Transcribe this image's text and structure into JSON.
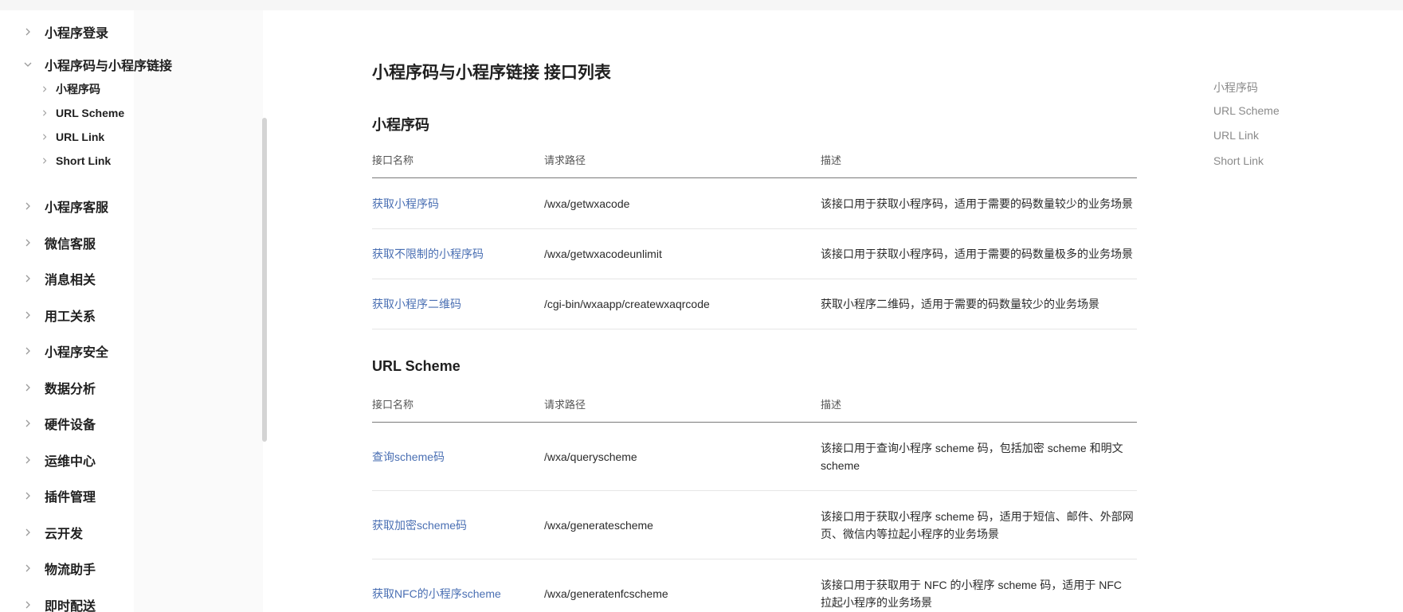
{
  "sidebar": {
    "items": [
      {
        "label": "小程序登录",
        "expanded": false
      },
      {
        "label": "小程序码与小程序链接",
        "expanded": true
      },
      {
        "label": "小程序客服",
        "expanded": false
      },
      {
        "label": "微信客服",
        "expanded": false
      },
      {
        "label": "消息相关",
        "expanded": false
      },
      {
        "label": "用工关系",
        "expanded": false
      },
      {
        "label": "小程序安全",
        "expanded": false
      },
      {
        "label": "数据分析",
        "expanded": false
      },
      {
        "label": "硬件设备",
        "expanded": false
      },
      {
        "label": "运维中心",
        "expanded": false
      },
      {
        "label": "插件管理",
        "expanded": false
      },
      {
        "label": "云开发",
        "expanded": false
      },
      {
        "label": "物流助手",
        "expanded": false
      },
      {
        "label": "即时配送",
        "expanded": false
      }
    ],
    "subitems": [
      {
        "label": "小程序码"
      },
      {
        "label": "URL Scheme"
      },
      {
        "label": "URL Link"
      },
      {
        "label": "Short Link"
      }
    ]
  },
  "main": {
    "title": "小程序码与小程序链接 接口列表",
    "columns": [
      "接口名称",
      "请求路径",
      "描述"
    ],
    "sections": [
      {
        "title": "小程序码",
        "rows": [
          {
            "name": "获取小程序码",
            "path": "/wxa/getwxacode",
            "desc": "该接口用于获取小程序码，适用于需要的码数量较少的业务场景"
          },
          {
            "name": "获取不限制的小程序码",
            "path": "/wxa/getwxacodeunlimit",
            "desc": "该接口用于获取小程序码，适用于需要的码数量极多的业务场景"
          },
          {
            "name": "获取小程序二维码",
            "path": "/cgi-bin/wxaapp/createwxaqrcode",
            "desc": "获取小程序二维码，适用于需要的码数量较少的业务场景"
          }
        ]
      },
      {
        "title": "URL Scheme",
        "rows": [
          {
            "name": "查询scheme码",
            "path": "/wxa/queryscheme",
            "desc": "该接口用于查询小程序 scheme 码，包括加密 scheme 和明文 scheme"
          },
          {
            "name": "获取加密scheme码",
            "path": "/wxa/generatescheme",
            "desc": "该接口用于获取小程序 scheme 码，适用于短信、邮件、外部网页、微信内等拉起小程序的业务场景"
          },
          {
            "name": "获取NFC的小程序scheme",
            "path": "/wxa/generatenfcscheme",
            "desc": "该接口用于获取用于 NFC 的小程序 scheme 码，适用于 NFC 拉起小程序的业务场景"
          }
        ]
      }
    ]
  },
  "toc": {
    "items": [
      "小程序码",
      "URL Scheme",
      "URL Link",
      "Short Link"
    ]
  },
  "colors": {
    "link": "#4a6fb3",
    "toc_text": "#8a8a8a",
    "header_rule": "#7a7a7a"
  }
}
